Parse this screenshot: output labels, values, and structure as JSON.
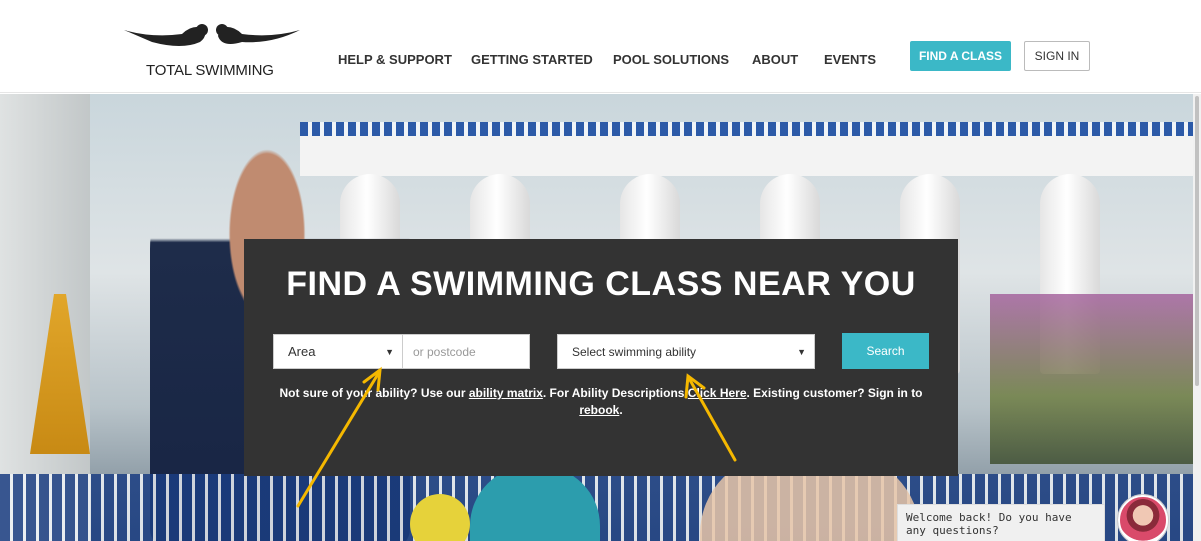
{
  "brand": {
    "name": "TOTAL SWIMMING"
  },
  "nav": {
    "items": [
      {
        "label": "HELP & SUPPORT"
      },
      {
        "label": "GETTING STARTED"
      },
      {
        "label": "POOL SOLUTIONS"
      },
      {
        "label": "ABOUT"
      },
      {
        "label": "EVENTS"
      }
    ],
    "find_class": "FIND A CLASS",
    "sign_in": "SIGN IN"
  },
  "search": {
    "title": "FIND A SWIMMING CLASS NEAR YOU",
    "area_label": "Area",
    "postcode_placeholder": "or postcode",
    "ability_label": "Select swimming ability",
    "search_button": "Search",
    "help": {
      "part1": "Not sure of your ability? Use our ",
      "ability_matrix_link": "ability matrix",
      "part2": ". For Ability Descriptions ",
      "click_here_link": "Click Here",
      "part3": ". Existing customer? Sign in to ",
      "rebook_link": "rebook",
      "part4": "."
    }
  },
  "chat": {
    "message": "Welcome back! Do you have any questions?"
  },
  "colors": {
    "accent": "#3bb8c7",
    "panel": "#333333",
    "arrow": "#f5b800"
  }
}
